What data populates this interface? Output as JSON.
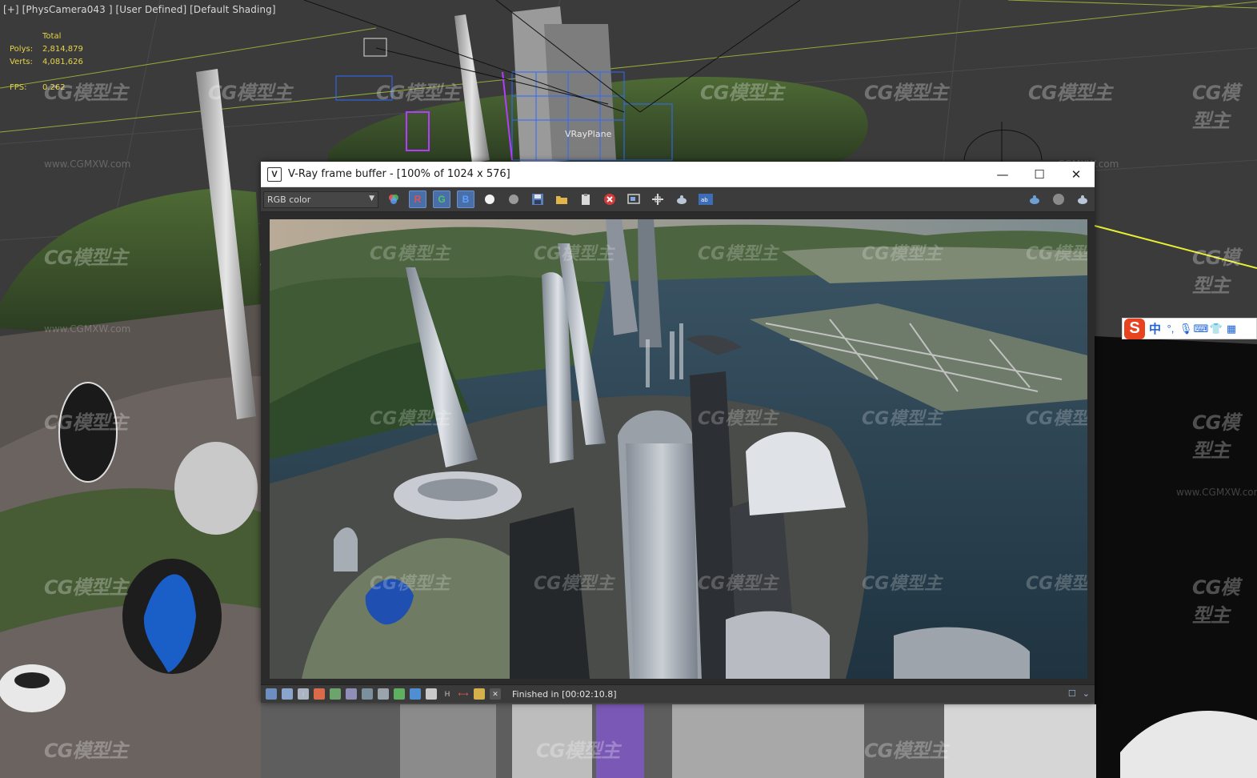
{
  "viewport": {
    "label": "[+] [PhysCamera043 ] [User Defined] [Default Shading]",
    "stats": {
      "header": "Total",
      "polys_label": "Polys:",
      "polys_value": "2,814,879",
      "verts_label": "Verts:",
      "verts_value": "4,081,626",
      "fps_label": "FPS:",
      "fps_value": "0.262"
    },
    "object_label": "VRayPlane",
    "watermark_text": "CG模型主",
    "watermark_url": "www.CGMXW.com"
  },
  "ime_toolbar": {
    "logo": "S",
    "mode": "中",
    "icons": [
      "punctuation-icon",
      "microphone-icon",
      "keyboard-icon",
      "shirt-icon",
      "menu-icon"
    ]
  },
  "vfb": {
    "title": "V-Ray frame buffer - [100% of 1024 x 576]",
    "window_buttons": {
      "minimize": "—",
      "maximize": "☐",
      "close": "✕"
    },
    "channel": "RGB color",
    "channel_buttons": {
      "r": "R",
      "g": "G",
      "b": "B"
    },
    "status": "Finished in [00:02:10.8]"
  },
  "colors": {
    "viewport_bg": "#3a3a3a",
    "grid_yellow": "#d8e43a",
    "selection_blue": "#2f6bff",
    "stats_yellow": "#e6d44a",
    "vfb_toolbar": "#3c3c3c",
    "ime_accent": "#1e63d6",
    "ime_logo": "#e8431f"
  }
}
